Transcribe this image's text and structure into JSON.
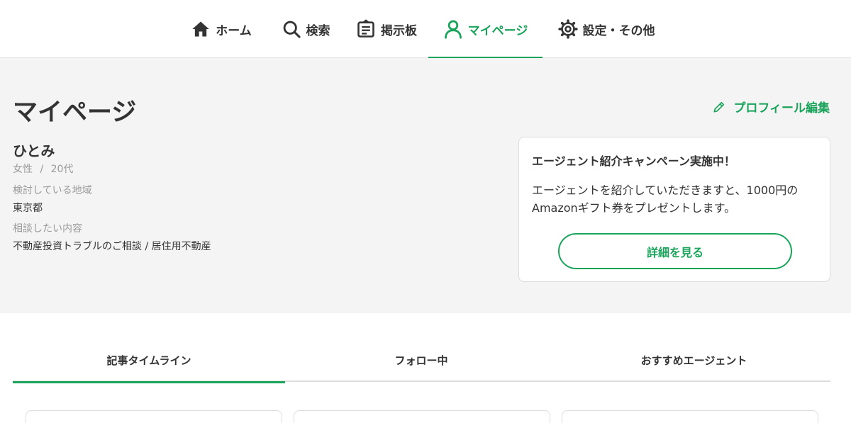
{
  "nav": {
    "items": [
      {
        "label": "ホーム",
        "icon": "home-icon"
      },
      {
        "label": "検索",
        "icon": "search-icon"
      },
      {
        "label": "掲示板",
        "icon": "board-icon"
      },
      {
        "label": "マイページ",
        "icon": "user-icon",
        "active": true
      },
      {
        "label": "設定・その他",
        "icon": "gear-icon"
      }
    ]
  },
  "profile": {
    "page_title": "マイページ",
    "edit_label": "プロフィール編集",
    "edit_icon": "pencil-icon",
    "name": "ひとみ",
    "gender": "女性",
    "separator": "/",
    "age": "20代",
    "area_label": "検討している地域",
    "area_value": "東京都",
    "topic_label": "相談したい内容",
    "topic_value": "不動産投資トラブルのご相談 / 居住用不動産"
  },
  "campaign": {
    "title": "エージェント紹介キャンペーン実施中！",
    "body": "エージェントを紹介していただきますと、1000円のAmazonギフト券をプレゼントします。",
    "button_label": "詳細を見る"
  },
  "tabs": [
    {
      "label": "記事タイムライン",
      "active": true
    },
    {
      "label": "フォロー中"
    },
    {
      "label": "おすすめエージェント"
    }
  ],
  "colors": {
    "accent": "#1aa35a",
    "background": "#f4f4f4",
    "text": "#333333",
    "muted": "#9a9a9a"
  }
}
